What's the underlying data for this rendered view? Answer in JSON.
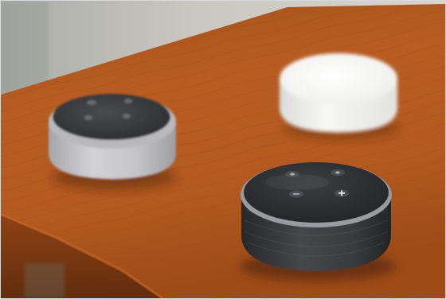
{
  "scene": {
    "subject": "smart-speakers-on-table",
    "speakers": [
      {
        "id": "left",
        "body_color": "#c9c9cc",
        "top_color": "#3a3b3e",
        "buttons": 4
      },
      {
        "id": "right",
        "body_color": "#f2f2f0",
        "top_color": "#f7f7f5",
        "buttons": 0
      },
      {
        "id": "front",
        "body_color": "#38393c",
        "top_color": "#2c2d30",
        "buttons": 4
      }
    ],
    "table_color": "#b55a1f",
    "wall_color": "#cfcbc4"
  }
}
